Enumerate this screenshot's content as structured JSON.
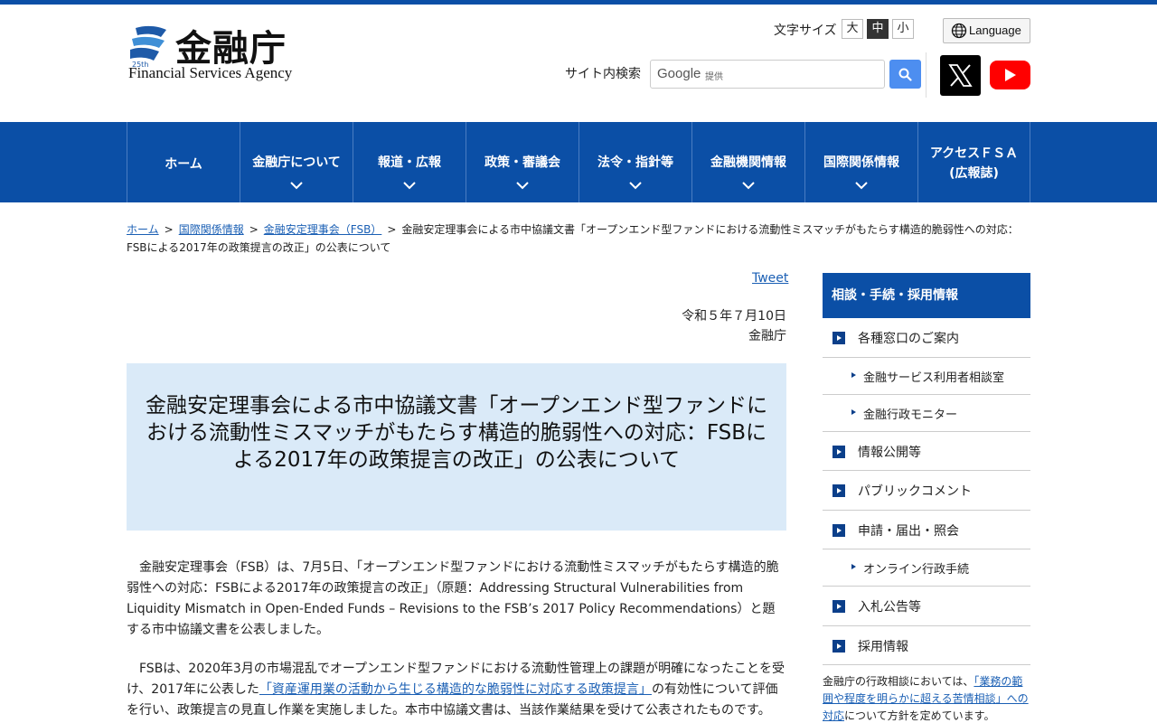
{
  "header": {
    "logo_jp": "金融庁",
    "logo_en": "Financial Services Agency",
    "font_size_label": "文字サイズ",
    "font_sizes": [
      "大",
      "中",
      "小"
    ],
    "font_size_selected": "中",
    "language_label": "Language",
    "search_label": "サイト内検索",
    "search_brand": "Google",
    "search_brand_suffix": "提供"
  },
  "nav": {
    "items": [
      {
        "label": "ホーム"
      },
      {
        "label": "金融庁について"
      },
      {
        "label": "報道・広報"
      },
      {
        "label": "政策・審議会"
      },
      {
        "label": "法令・指針等"
      },
      {
        "label": "金融機関情報"
      },
      {
        "label": "国際関係情報"
      },
      {
        "label": "アクセスＦＳＡ",
        "label2": "(広報誌)"
      }
    ]
  },
  "breadcrumb": {
    "home": "ホーム",
    "l1": "国際関係情報",
    "l2": "金融安定理事会（FSB）",
    "sep": ">",
    "current": "金融安定理事会による市中協議文書「オープンエンド型ファンドにおける流動性ミスマッチがもたらす構造的脆弱性への対応：FSBによる2017年の政策提言の改正」の公表について"
  },
  "main": {
    "tweet": "Tweet",
    "date": "令和５年７月10日",
    "issuer": "金融庁",
    "title": "金融安定理事会による市中協議文書「オープンエンド型ファンドにおける流動性ミスマッチがもたらす構造的脆弱性への対応：FSBによる2017年の政策提言の改正」の公表について",
    "para1": "金融安定理事会（FSB）は、7月5日、「オープンエンド型ファンドにおける流動性ミスマッチがもたらす構造的脆弱性への対応：FSBによる2017年の政策提言の改正」（原題：Addressing Structural Vulnerabilities from Liquidity Mismatch in Open-Ended Funds – Revisions to the FSB’s 2017 Policy Recommendations）と題する市中協議文書を公表しました。",
    "para2_a": "FSBは、2020年3月の市場混乱でオープンエンド型ファンドにおける流動性管理上の課題が明確になったことを受け、2017年に公表した",
    "para2_link": "「資産運用業の活動から生じる構造的な脆弱性に対応する政策提言」",
    "para2_b": "の有効性について評価を行い、政策提言の見直し作業を実施しました。本市中協議文書は、当該作業結果を受けて公表されたものです。"
  },
  "sidebar": {
    "heading": "相談・手続・採用情報",
    "items": [
      {
        "label": "各種窓口のご案内"
      },
      {
        "label": "金融サービス利用者相談室"
      },
      {
        "label": "金融行政モニター"
      },
      {
        "label": "情報公開等"
      },
      {
        "label": "パブリックコメント"
      },
      {
        "label": "申請・届出・照会"
      },
      {
        "label": "オンライン行政手続"
      },
      {
        "label": "入札公告等"
      },
      {
        "label": "採用情報"
      }
    ],
    "note_a": "金融庁の行政相談においては、",
    "note_link": "「業務の範囲や程度を明らかに超える苦情相談」への対応",
    "note_b": "について方針を定めています。"
  }
}
